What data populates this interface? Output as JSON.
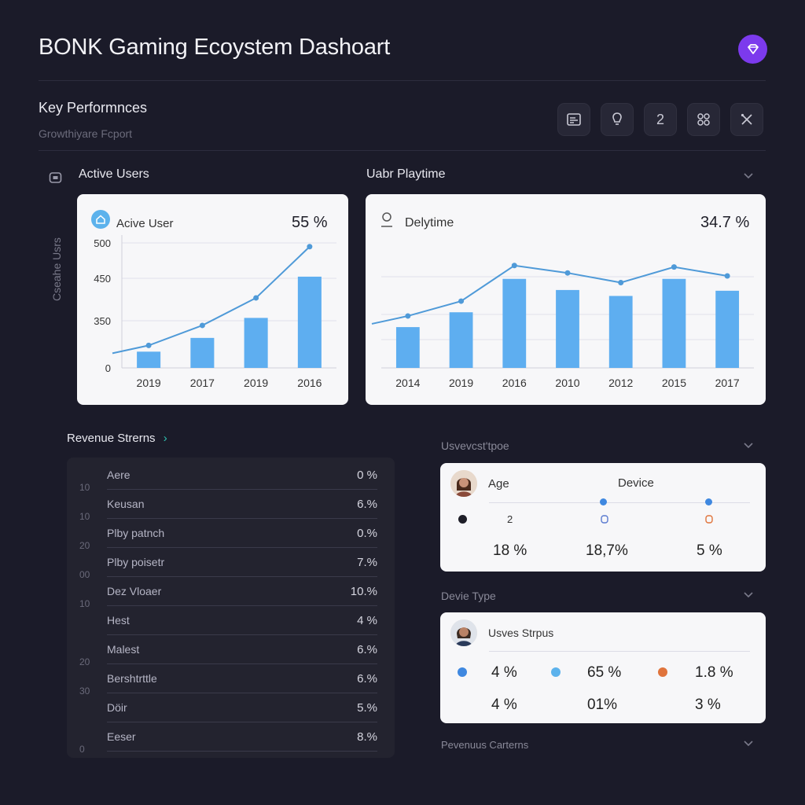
{
  "header": {
    "title": "BONK Gaming Ecoystem Dashoart"
  },
  "key_performance": {
    "title": "Key Performnces",
    "subtitle": "Growthiyare Fcport"
  },
  "toolbar": {
    "button3_label": "2"
  },
  "active_users": {
    "section_label": "Active Users",
    "side_label": "Cseahe Usrs",
    "card_title": "Acive User",
    "card_value": "55 %"
  },
  "playtime": {
    "section_label": "Uabr Playtime",
    "card_title": "Delytime",
    "card_value": "34.7 %"
  },
  "revenue": {
    "label": "Revenue Strerns",
    "arrow": "›",
    "row_numbers": [
      "10",
      "10",
      "20",
      "00",
      "10",
      "",
      "20",
      "30",
      "",
      "0"
    ],
    "rows": [
      {
        "name": "Aere",
        "value": "0 %"
      },
      {
        "name": "Keusan",
        "value": "6.%"
      },
      {
        "name": "Plby patnch",
        "value": "0.%"
      },
      {
        "name": "Plby poisetr",
        "value": "7.%"
      },
      {
        "name": "Dez Vloaer",
        "value": "10.%"
      },
      {
        "name": "Hest",
        "value": "4 %"
      },
      {
        "name": "Malest",
        "value": "6.%"
      },
      {
        "name": "Bershtrttle",
        "value": "6.%"
      },
      {
        "name": "Döir",
        "value": "5.%"
      },
      {
        "name": "Eeser",
        "value": "8.%"
      }
    ]
  },
  "users_type": {
    "label": "Usvevcst'tpoe",
    "age_label": "Age",
    "device_label": "Device",
    "small_value": "2",
    "stats": [
      "18 %",
      "18,7%",
      "5 %"
    ]
  },
  "device_type": {
    "label": "Devie Type",
    "card_title": "Usves Strpus",
    "row1": [
      "4 %",
      "65 %",
      "1.8 %"
    ],
    "row2": [
      "4 %",
      "01%",
      "3 %"
    ]
  },
  "footer": {
    "label": "Pevenuus Carterns"
  },
  "colors": {
    "accent": "#7c3aed",
    "bar": "#5eaef0",
    "line": "#4f9ad8",
    "dot_blue": "#3f88e0",
    "dot_sky": "#5cb2ec",
    "dot_orange": "#e0743c"
  },
  "chart_data": [
    {
      "type": "bar",
      "title": "Acive User",
      "categories": [
        "2019",
        "2017",
        "2019",
        "2016"
      ],
      "values": [
        65,
        120,
        200,
        365
      ],
      "line": [
        90,
        170,
        280,
        485
      ],
      "yticks": [
        "0",
        "350",
        "450",
        "500"
      ],
      "ylim": [
        0,
        500
      ]
    },
    {
      "type": "bar",
      "title": "Delytime",
      "categories": [
        "2014",
        "2019",
        "2016",
        "2010",
        "2012",
        "2015",
        "2017"
      ],
      "values": [
        55,
        75,
        120,
        105,
        97,
        120,
        104
      ],
      "line": [
        70,
        90,
        138,
        128,
        115,
        136,
        124
      ],
      "ylim": [
        0,
        160
      ]
    }
  ]
}
